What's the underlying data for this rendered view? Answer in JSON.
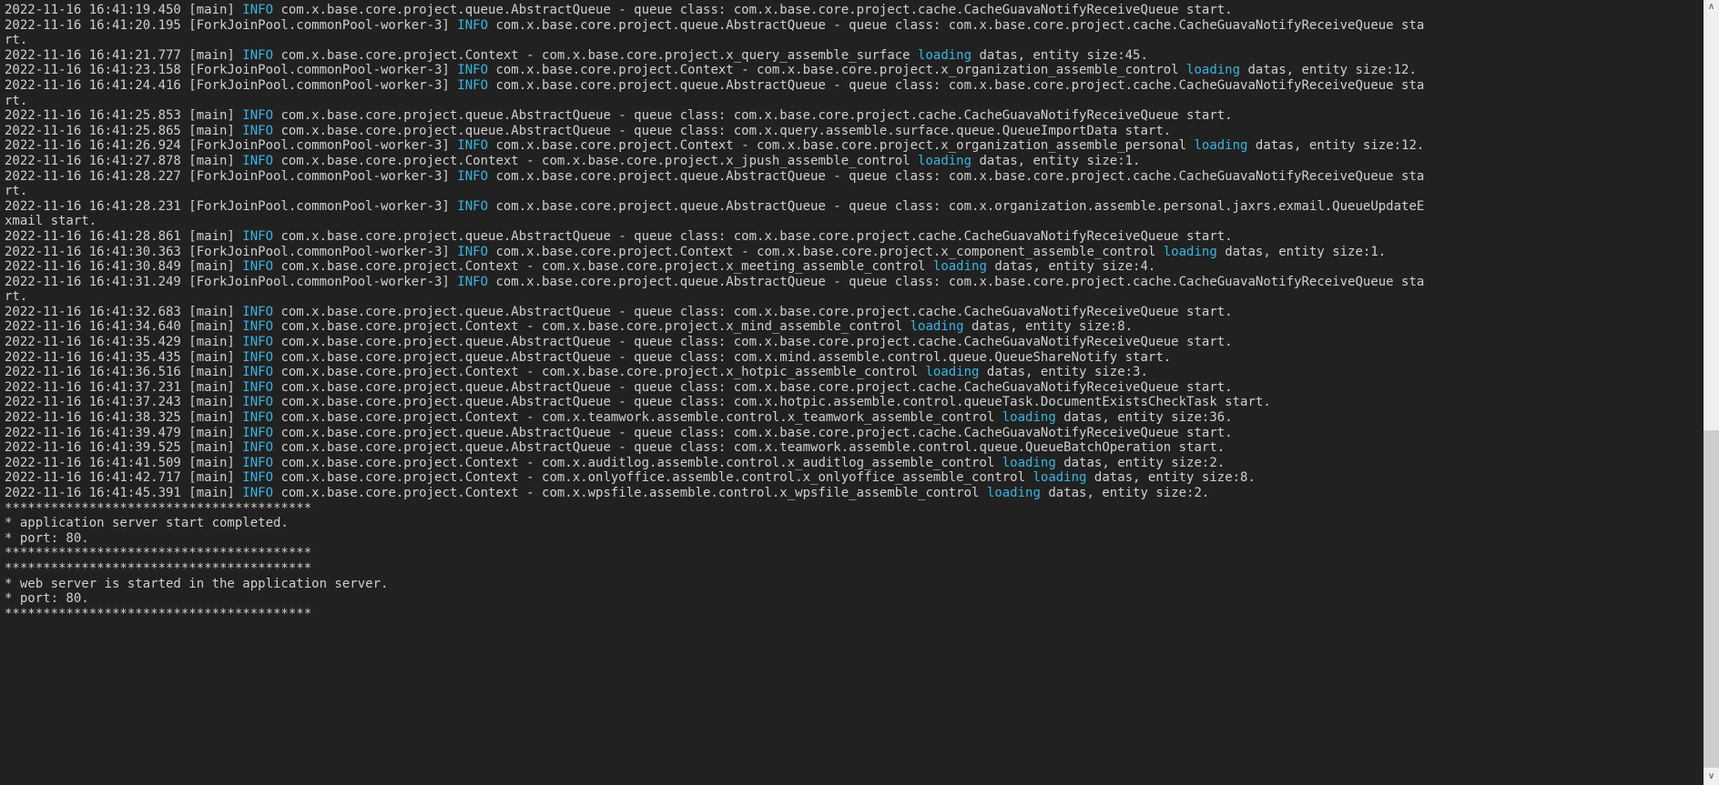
{
  "terminal": {
    "colors": {
      "background": "#212121",
      "foreground": "#d0d0d0",
      "accent": "#3ab5e0",
      "scrollbar_track": "#f0f0f0",
      "scrollbar_thumb": "#cdcdcd"
    },
    "scrollbar": {
      "up_icon": "∧",
      "down_icon": "∨"
    },
    "rows": [
      {
        "segments": [
          {
            "t": "2022-11-16 16:41:19.450 [main] "
          },
          {
            "t": "INFO",
            "c": "accent"
          },
          {
            "t": " com.x.base.core.project.queue.AbstractQueue - queue class: com.x.base.core.project.cache.CacheGuavaNotifyReceiveQueue start."
          }
        ]
      },
      {
        "segments": [
          {
            "t": "2022-11-16 16:41:20.195 [ForkJoinPool.commonPool-worker-3] "
          },
          {
            "t": "INFO",
            "c": "accent"
          },
          {
            "t": " com.x.base.core.project.queue.AbstractQueue - queue class: com.x.base.core.project.cache.CacheGuavaNotifyReceiveQueue sta"
          }
        ]
      },
      {
        "segments": [
          {
            "t": "rt."
          }
        ]
      },
      {
        "segments": [
          {
            "t": "2022-11-16 16:41:21.777 [main] "
          },
          {
            "t": "INFO",
            "c": "accent"
          },
          {
            "t": " com.x.base.core.project.Context - com.x.base.core.project.x_query_assemble_surface "
          },
          {
            "t": "loading",
            "c": "accent"
          },
          {
            "t": " datas, entity size:45."
          }
        ]
      },
      {
        "segments": [
          {
            "t": "2022-11-16 16:41:23.158 [ForkJoinPool.commonPool-worker-3] "
          },
          {
            "t": "INFO",
            "c": "accent"
          },
          {
            "t": " com.x.base.core.project.Context - com.x.base.core.project.x_organization_assemble_control "
          },
          {
            "t": "loading",
            "c": "accent"
          },
          {
            "t": " datas, entity size:12."
          }
        ]
      },
      {
        "segments": [
          {
            "t": "2022-11-16 16:41:24.416 [ForkJoinPool.commonPool-worker-3] "
          },
          {
            "t": "INFO",
            "c": "accent"
          },
          {
            "t": " com.x.base.core.project.queue.AbstractQueue - queue class: com.x.base.core.project.cache.CacheGuavaNotifyReceiveQueue sta"
          }
        ]
      },
      {
        "segments": [
          {
            "t": "rt."
          }
        ]
      },
      {
        "segments": [
          {
            "t": "2022-11-16 16:41:25.853 [main] "
          },
          {
            "t": "INFO",
            "c": "accent"
          },
          {
            "t": " com.x.base.core.project.queue.AbstractQueue - queue class: com.x.base.core.project.cache.CacheGuavaNotifyReceiveQueue start."
          }
        ]
      },
      {
        "segments": [
          {
            "t": "2022-11-16 16:41:25.865 [main] "
          },
          {
            "t": "INFO",
            "c": "accent"
          },
          {
            "t": " com.x.base.core.project.queue.AbstractQueue - queue class: com.x.query.assemble.surface.queue.QueueImportData start."
          }
        ]
      },
      {
        "segments": [
          {
            "t": "2022-11-16 16:41:26.924 [ForkJoinPool.commonPool-worker-3] "
          },
          {
            "t": "INFO",
            "c": "accent"
          },
          {
            "t": " com.x.base.core.project.Context - com.x.base.core.project.x_organization_assemble_personal "
          },
          {
            "t": "loading",
            "c": "accent"
          },
          {
            "t": " datas, entity size:12."
          }
        ]
      },
      {
        "segments": [
          {
            "t": "2022-11-16 16:41:27.878 [main] "
          },
          {
            "t": "INFO",
            "c": "accent"
          },
          {
            "t": " com.x.base.core.project.Context - com.x.base.core.project.x_jpush_assemble_control "
          },
          {
            "t": "loading",
            "c": "accent"
          },
          {
            "t": " datas, entity size:1."
          }
        ]
      },
      {
        "segments": [
          {
            "t": "2022-11-16 16:41:28.227 [ForkJoinPool.commonPool-worker-3] "
          },
          {
            "t": "INFO",
            "c": "accent"
          },
          {
            "t": " com.x.base.core.project.queue.AbstractQueue - queue class: com.x.base.core.project.cache.CacheGuavaNotifyReceiveQueue sta"
          }
        ]
      },
      {
        "segments": [
          {
            "t": "rt."
          }
        ]
      },
      {
        "segments": [
          {
            "t": "2022-11-16 16:41:28.231 [ForkJoinPool.commonPool-worker-3] "
          },
          {
            "t": "INFO",
            "c": "accent"
          },
          {
            "t": " com.x.base.core.project.queue.AbstractQueue - queue class: com.x.organization.assemble.personal.jaxrs.exmail.QueueUpdateE"
          }
        ]
      },
      {
        "segments": [
          {
            "t": "xmail start."
          }
        ]
      },
      {
        "segments": [
          {
            "t": "2022-11-16 16:41:28.861 [main] "
          },
          {
            "t": "INFO",
            "c": "accent"
          },
          {
            "t": " com.x.base.core.project.queue.AbstractQueue - queue class: com.x.base.core.project.cache.CacheGuavaNotifyReceiveQueue start."
          }
        ]
      },
      {
        "segments": [
          {
            "t": "2022-11-16 16:41:30.363 [ForkJoinPool.commonPool-worker-3] "
          },
          {
            "t": "INFO",
            "c": "accent"
          },
          {
            "t": " com.x.base.core.project.Context - com.x.base.core.project.x_component_assemble_control "
          },
          {
            "t": "loading",
            "c": "accent"
          },
          {
            "t": " datas, entity size:1."
          }
        ]
      },
      {
        "segments": [
          {
            "t": "2022-11-16 16:41:30.849 [main] "
          },
          {
            "t": "INFO",
            "c": "accent"
          },
          {
            "t": " com.x.base.core.project.Context - com.x.base.core.project.x_meeting_assemble_control "
          },
          {
            "t": "loading",
            "c": "accent"
          },
          {
            "t": " datas, entity size:4."
          }
        ]
      },
      {
        "segments": [
          {
            "t": "2022-11-16 16:41:31.249 [ForkJoinPool.commonPool-worker-3] "
          },
          {
            "t": "INFO",
            "c": "accent"
          },
          {
            "t": " com.x.base.core.project.queue.AbstractQueue - queue class: com.x.base.core.project.cache.CacheGuavaNotifyReceiveQueue sta"
          }
        ]
      },
      {
        "segments": [
          {
            "t": "rt."
          }
        ]
      },
      {
        "segments": [
          {
            "t": "2022-11-16 16:41:32.683 [main] "
          },
          {
            "t": "INFO",
            "c": "accent"
          },
          {
            "t": " com.x.base.core.project.queue.AbstractQueue - queue class: com.x.base.core.project.cache.CacheGuavaNotifyReceiveQueue start."
          }
        ]
      },
      {
        "segments": [
          {
            "t": "2022-11-16 16:41:34.640 [main] "
          },
          {
            "t": "INFO",
            "c": "accent"
          },
          {
            "t": " com.x.base.core.project.Context - com.x.base.core.project.x_mind_assemble_control "
          },
          {
            "t": "loading",
            "c": "accent"
          },
          {
            "t": " datas, entity size:8."
          }
        ]
      },
      {
        "segments": [
          {
            "t": "2022-11-16 16:41:35.429 [main] "
          },
          {
            "t": "INFO",
            "c": "accent"
          },
          {
            "t": " com.x.base.core.project.queue.AbstractQueue - queue class: com.x.base.core.project.cache.CacheGuavaNotifyReceiveQueue start."
          }
        ]
      },
      {
        "segments": [
          {
            "t": "2022-11-16 16:41:35.435 [main] "
          },
          {
            "t": "INFO",
            "c": "accent"
          },
          {
            "t": " com.x.base.core.project.queue.AbstractQueue - queue class: com.x.mind.assemble.control.queue.QueueShareNotify start."
          }
        ]
      },
      {
        "segments": [
          {
            "t": "2022-11-16 16:41:36.516 [main] "
          },
          {
            "t": "INFO",
            "c": "accent"
          },
          {
            "t": " com.x.base.core.project.Context - com.x.base.core.project.x_hotpic_assemble_control "
          },
          {
            "t": "loading",
            "c": "accent"
          },
          {
            "t": " datas, entity size:3."
          }
        ]
      },
      {
        "segments": [
          {
            "t": "2022-11-16 16:41:37.231 [main] "
          },
          {
            "t": "INFO",
            "c": "accent"
          },
          {
            "t": " com.x.base.core.project.queue.AbstractQueue - queue class: com.x.base.core.project.cache.CacheGuavaNotifyReceiveQueue start."
          }
        ]
      },
      {
        "segments": [
          {
            "t": "2022-11-16 16:41:37.243 [main] "
          },
          {
            "t": "INFO",
            "c": "accent"
          },
          {
            "t": " com.x.base.core.project.queue.AbstractQueue - queue class: com.x.hotpic.assemble.control.queueTask.DocumentExistsCheckTask start."
          }
        ]
      },
      {
        "segments": [
          {
            "t": "2022-11-16 16:41:38.325 [main] "
          },
          {
            "t": "INFO",
            "c": "accent"
          },
          {
            "t": " com.x.base.core.project.Context - com.x.teamwork.assemble.control.x_teamwork_assemble_control "
          },
          {
            "t": "loading",
            "c": "accent"
          },
          {
            "t": " datas, entity size:36."
          }
        ]
      },
      {
        "segments": [
          {
            "t": "2022-11-16 16:41:39.479 [main] "
          },
          {
            "t": "INFO",
            "c": "accent"
          },
          {
            "t": " com.x.base.core.project.queue.AbstractQueue - queue class: com.x.base.core.project.cache.CacheGuavaNotifyReceiveQueue start."
          }
        ]
      },
      {
        "segments": [
          {
            "t": "2022-11-16 16:41:39.525 [main] "
          },
          {
            "t": "INFO",
            "c": "accent"
          },
          {
            "t": " com.x.base.core.project.queue.AbstractQueue - queue class: com.x.teamwork.assemble.control.queue.QueueBatchOperation start."
          }
        ]
      },
      {
        "segments": [
          {
            "t": "2022-11-16 16:41:41.509 [main] "
          },
          {
            "t": "INFO",
            "c": "accent"
          },
          {
            "t": " com.x.base.core.project.Context - com.x.auditlog.assemble.control.x_auditlog_assemble_control "
          },
          {
            "t": "loading",
            "c": "accent"
          },
          {
            "t": " datas, entity size:2."
          }
        ]
      },
      {
        "segments": [
          {
            "t": "2022-11-16 16:41:42.717 [main] "
          },
          {
            "t": "INFO",
            "c": "accent"
          },
          {
            "t": " com.x.base.core.project.Context - com.x.onlyoffice.assemble.control.x_onlyoffice_assemble_control "
          },
          {
            "t": "loading",
            "c": "accent"
          },
          {
            "t": " datas, entity size:8."
          }
        ]
      },
      {
        "segments": [
          {
            "t": "2022-11-16 16:41:45.391 [main] "
          },
          {
            "t": "INFO",
            "c": "accent"
          },
          {
            "t": " com.x.base.core.project.Context - com.x.wpsfile.assemble.control.x_wpsfile_assemble_control "
          },
          {
            "t": "loading",
            "c": "accent"
          },
          {
            "t": " datas, entity size:2."
          }
        ]
      },
      {
        "segments": [
          {
            "t": "****************************************"
          }
        ]
      },
      {
        "segments": [
          {
            "t": "* application server start completed."
          }
        ]
      },
      {
        "segments": [
          {
            "t": "* port: 80."
          }
        ]
      },
      {
        "segments": [
          {
            "t": "****************************************"
          }
        ]
      },
      {
        "segments": [
          {
            "t": "****************************************"
          }
        ]
      },
      {
        "segments": [
          {
            "t": "* web server is started in the application server."
          }
        ]
      },
      {
        "segments": [
          {
            "t": "* port: 80."
          }
        ]
      },
      {
        "segments": [
          {
            "t": "****************************************"
          }
        ]
      }
    ]
  }
}
